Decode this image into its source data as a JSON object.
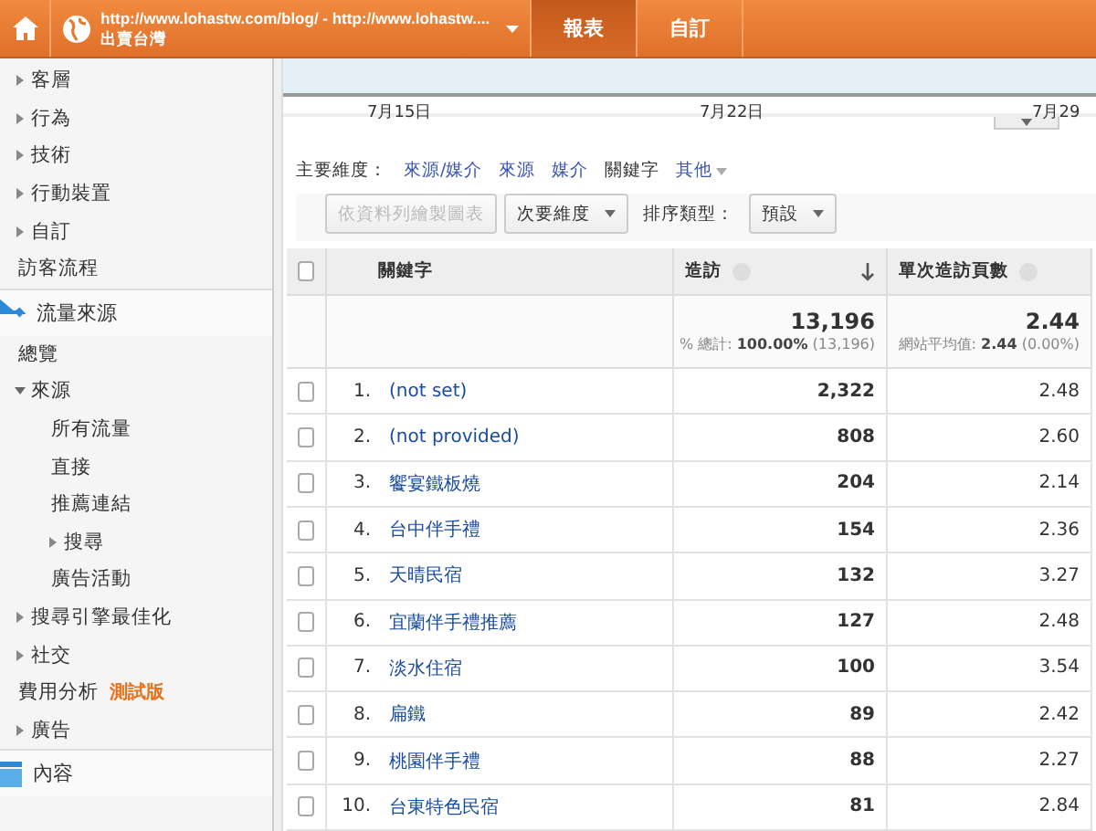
{
  "header": {
    "account_url": "http://www.lohastw.com/blog/ - http://www.lohastw....",
    "account_name": "出賣台灣",
    "tabs": [
      {
        "label": "報表",
        "selected": true
      },
      {
        "label": "自訂",
        "selected": false
      }
    ]
  },
  "sidebar": {
    "items": [
      {
        "label": "客層",
        "kind": "collapsed"
      },
      {
        "label": "行為",
        "kind": "collapsed"
      },
      {
        "label": "技術",
        "kind": "collapsed"
      },
      {
        "label": "行動裝置",
        "kind": "collapsed"
      },
      {
        "label": "自訂",
        "kind": "collapsed"
      },
      {
        "label": "訪客流程",
        "kind": "leaf"
      }
    ],
    "sections": [
      {
        "label": "流量來源",
        "children": [
          {
            "label": "總覽",
            "kind": "leaf"
          },
          {
            "label": "來源",
            "kind": "expanded",
            "children": [
              {
                "label": "所有流量",
                "kind": "leaf"
              },
              {
                "label": "直接",
                "kind": "leaf"
              },
              {
                "label": "推薦連結",
                "kind": "leaf"
              },
              {
                "label": "搜尋",
                "kind": "collapsed"
              },
              {
                "label": "廣告活動",
                "kind": "leaf"
              }
            ]
          },
          {
            "label": "搜尋引擎最佳化",
            "kind": "collapsed"
          },
          {
            "label": "社交",
            "kind": "collapsed"
          },
          {
            "label": "費用分析",
            "kind": "leaf",
            "badge": "測試版"
          },
          {
            "label": "廣告",
            "kind": "collapsed"
          }
        ]
      },
      {
        "label": "內容"
      }
    ]
  },
  "chart": {
    "x_labels": [
      "7月15日",
      "7月22日",
      "7月29"
    ]
  },
  "primary_dimension": {
    "label": "主要維度：",
    "options": [
      {
        "label": "來源/媒介",
        "selected": false
      },
      {
        "label": "來源",
        "selected": false
      },
      {
        "label": "媒介",
        "selected": false
      },
      {
        "label": "關鍵字",
        "selected": true
      },
      {
        "label": "其他",
        "selected": false
      }
    ]
  },
  "toolbar": {
    "plot_button": "依資料列繪製圖表",
    "secondary_dimension": "次要維度",
    "sort_label": "排序類型：",
    "sort_value": "預設"
  },
  "table": {
    "select_all_checked": false,
    "columns": [
      {
        "label": "關鍵字",
        "help": false,
        "sorted": false
      },
      {
        "label": "造訪",
        "help": true,
        "sorted": true
      },
      {
        "label": "單次造訪頁數",
        "help": true,
        "sorted": false
      }
    ],
    "totals": [
      {
        "value": "13,196",
        "note": "% 總計: **100.00%** (13,196)"
      },
      {
        "value": "2.44",
        "note": "網站平均值: **2.44** (0.00%)"
      }
    ],
    "rows": [
      {
        "index": "1.",
        "keyword": "(not set)",
        "visits": "2,322",
        "pages": "2.48",
        "checked": false
      },
      {
        "index": "2.",
        "keyword": "(not provided)",
        "visits": "808",
        "pages": "2.60",
        "checked": false
      },
      {
        "index": "3.",
        "keyword": "饗宴鐵板燒",
        "visits": "204",
        "pages": "2.14",
        "checked": false
      },
      {
        "index": "4.",
        "keyword": "台中伴手禮",
        "visits": "154",
        "pages": "2.36",
        "checked": false
      },
      {
        "index": "5.",
        "keyword": "天晴民宿",
        "visits": "132",
        "pages": "3.27",
        "checked": false
      },
      {
        "index": "6.",
        "keyword": "宜蘭伴手禮推薦",
        "visits": "127",
        "pages": "2.48",
        "checked": false
      },
      {
        "index": "7.",
        "keyword": "淡水住宿",
        "visits": "100",
        "pages": "3.54",
        "checked": false
      },
      {
        "index": "8.",
        "keyword": "扁鐵",
        "visits": "89",
        "pages": "2.42",
        "checked": false
      },
      {
        "index": "9.",
        "keyword": "桃園伴手禮",
        "visits": "88",
        "pages": "2.27",
        "checked": false
      },
      {
        "index": "10.",
        "keyword": "台東特色民宿",
        "visits": "81",
        "pages": "2.84",
        "checked": false
      }
    ]
  }
}
